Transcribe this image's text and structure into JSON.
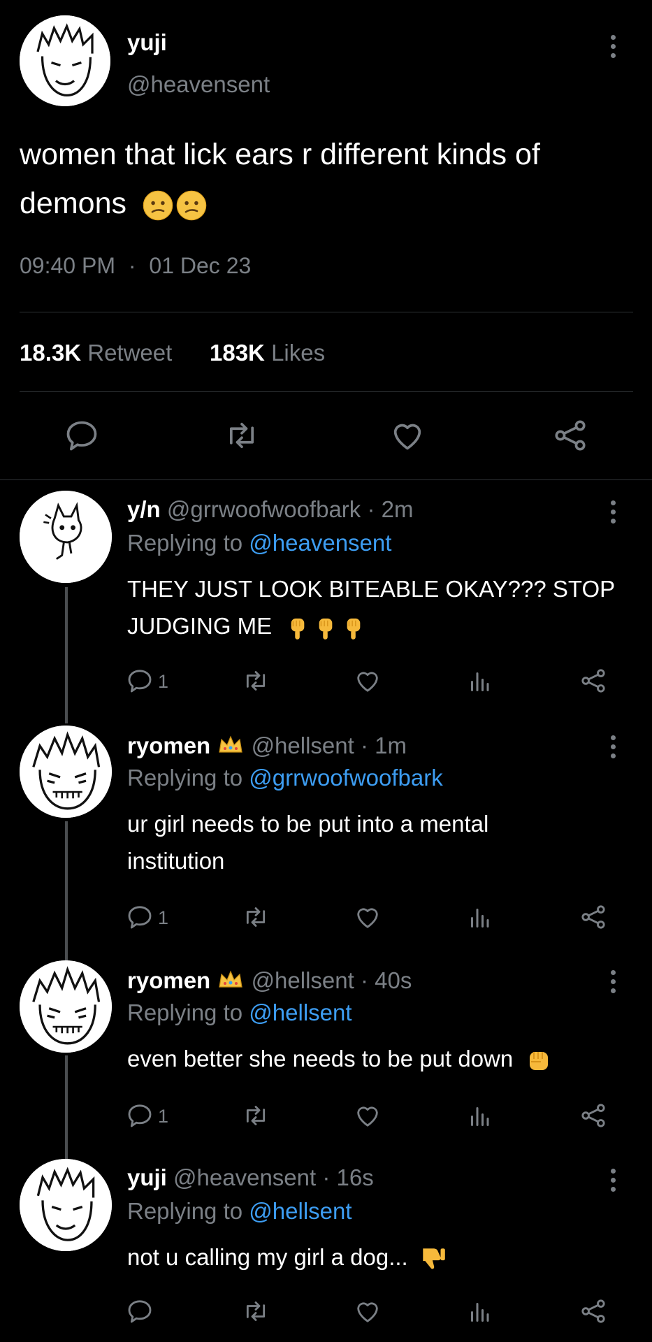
{
  "main_tweet": {
    "author_name": "yuji",
    "author_handle": "@heavensent",
    "text_line1": "women that lick ears r different kinds of",
    "text_line2": "demons",
    "time": "09:40 PM",
    "separator": "·",
    "date": "01 Dec 23",
    "retweet_count": "18.3K",
    "retweet_label": "Retweet",
    "like_count": "183K",
    "like_label": "Likes"
  },
  "replies": [
    {
      "name": "y/n",
      "handle": "@grrwoofwoofbark",
      "time": "· 2m",
      "replying_label": "Replying to",
      "replying_to": "@heavensent",
      "line1": "THEY JUST LOOK BITEABLE OKAY??? STOP",
      "line2": "JUDGING ME",
      "reply_count": "1"
    },
    {
      "name": "ryomen",
      "handle": "@hellsent",
      "time": "· 1m",
      "replying_label": "Replying to",
      "replying_to": "@grrwoofwoofbark",
      "line1": "ur girl needs to be put into a mental",
      "line2": "institution",
      "reply_count": "1"
    },
    {
      "name": "ryomen",
      "handle": "@hellsent",
      "time": "· 40s",
      "replying_label": "Replying to",
      "replying_to": "@hellsent",
      "line1": "even better she needs to be put down",
      "reply_count": "1"
    },
    {
      "name": "yuji",
      "handle": "@heavensent",
      "time": "· 16s",
      "replying_label": "Replying to",
      "replying_to": "@hellsent",
      "line1": "not u calling my girl a dog...",
      "reply_count": ""
    }
  ],
  "icons": {
    "reply": "reply-icon",
    "retweet": "retweet-icon",
    "like": "heart-icon",
    "share": "share-icon",
    "analytics": "analytics-icon",
    "more": "more-options-icon"
  },
  "colors": {
    "background": "#000000",
    "muted": "#7b8086",
    "link": "#3d9df2",
    "divider": "#2f3336"
  }
}
